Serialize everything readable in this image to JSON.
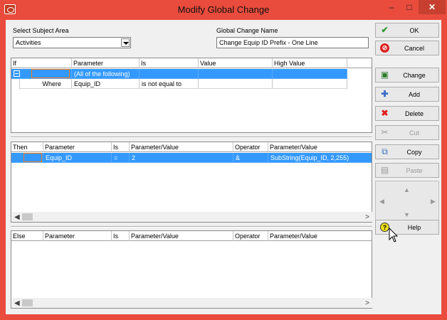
{
  "window": {
    "title": "Modify Global Change",
    "minimize": "–",
    "maximize": "□",
    "close": "✕"
  },
  "subject": {
    "label": "Select Subject Area",
    "value": "Activities"
  },
  "name": {
    "label": "Global Change Name",
    "value": "Change Equip ID Prefix - One Line"
  },
  "if_grid": {
    "headers": [
      "If",
      "Parameter",
      "Is",
      "Value",
      "High Value"
    ],
    "rows": [
      {
        "c1": "",
        "parameter": "(All of the following)",
        "is": "",
        "value": "",
        "high": ""
      },
      {
        "c1": "Where",
        "parameter": "Equip_ID",
        "is": "is not equal to",
        "value": "",
        "high": ""
      }
    ]
  },
  "then_grid": {
    "headers": [
      "Then",
      "Parameter",
      "Is",
      "Parameter/Value",
      "Operator",
      "Parameter/Value"
    ],
    "rows": [
      {
        "c0": "",
        "parameter": "Equip_ID",
        "is": "=",
        "pv1": "2",
        "operator": "&",
        "pv2": "SubString(Equip_ID, 2,255)"
      }
    ]
  },
  "else_grid": {
    "headers": [
      "Else",
      "Parameter",
      "Is",
      "Parameter/Value",
      "Operator",
      "Parameter/Value"
    ]
  },
  "buttons": {
    "ok": "OK",
    "cancel": "Cancel",
    "change": "Change",
    "add": "Add",
    "delete": "Delete",
    "cut": "Cut",
    "copy": "Copy",
    "paste": "Paste",
    "help": "Help"
  },
  "nav": {
    "left": "◀",
    "up": "▲",
    "down": "▼",
    "right": "▶"
  },
  "scroll": {
    "left": "◀",
    "right": ">"
  },
  "colors": {
    "titlebar": "#e94b3c",
    "selection": "#3399ff",
    "focus": "#f07a1c"
  }
}
